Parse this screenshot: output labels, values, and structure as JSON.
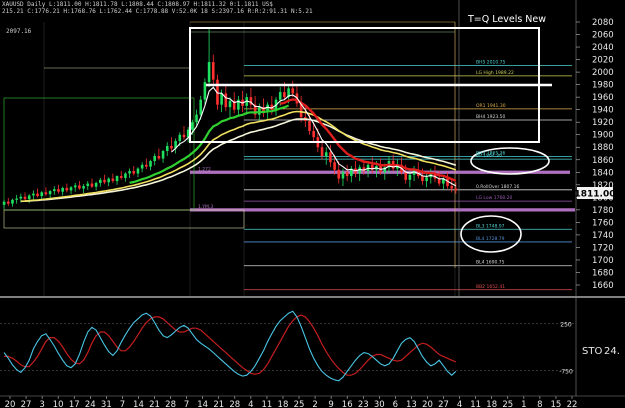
{
  "header": {
    "line1": "XAUUSD Daily  L:1811.00  H:1811.78  L:1808.44  C:1808.97  H:1811.32  0:1.1811  US$",
    "line2": "215.21  C:1776.21  H:1768.76  L:1762.44  C:1778.88  V:52.0K  18  S:2397.16  R:R:2:91.31  N:5.21",
    "line3": "2097.16"
  },
  "title": "T=Q Levels New",
  "price_label": "1811.00",
  "chart_data": {
    "type": "candlestick",
    "ylim": [
      1642,
      2100
    ],
    "y_ticks": [
      2080,
      2060,
      2040,
      2020,
      2000,
      1980,
      1960,
      1940,
      1920,
      1900,
      1880,
      1860,
      1840,
      1820,
      1800,
      1780,
      1760,
      1740,
      1720,
      1700,
      1680,
      1660
    ],
    "x_tick_labels": [
      "20",
      "27",
      "3",
      "10",
      "17",
      "24",
      "31",
      "7",
      "14",
      "21",
      "28",
      "7",
      "14",
      "21",
      "28",
      "4",
      "11",
      "18",
      "25",
      "2",
      "9",
      "16",
      "23",
      "30",
      "6",
      "13",
      "20",
      "27",
      "4",
      "11",
      "18",
      "25",
      "1",
      "8",
      "15",
      "22"
    ],
    "candles": [
      [
        1788,
        1796,
        1782,
        1793
      ],
      [
        1793,
        1799,
        1786,
        1790
      ],
      [
        1790,
        1798,
        1785,
        1796
      ],
      [
        1796,
        1804,
        1790,
        1798
      ],
      [
        1798,
        1806,
        1792,
        1801
      ],
      [
        1801,
        1808,
        1795,
        1797
      ],
      [
        1797,
        1805,
        1791,
        1803
      ],
      [
        1803,
        1811,
        1797,
        1806
      ],
      [
        1806,
        1814,
        1800,
        1802
      ],
      [
        1802,
        1810,
        1796,
        1808
      ],
      [
        1808,
        1816,
        1802,
        1805
      ],
      [
        1805,
        1812,
        1798,
        1810
      ],
      [
        1810,
        1818,
        1804,
        1813
      ],
      [
        1813,
        1820,
        1806,
        1809
      ],
      [
        1809,
        1817,
        1803,
        1815
      ],
      [
        1815,
        1822,
        1808,
        1811
      ],
      [
        1811,
        1818,
        1805,
        1816
      ],
      [
        1816,
        1823,
        1809,
        1819
      ],
      [
        1819,
        1826,
        1812,
        1814
      ],
      [
        1814,
        1821,
        1807,
        1818
      ],
      [
        1818,
        1826,
        1812,
        1822
      ],
      [
        1822,
        1830,
        1815,
        1817
      ],
      [
        1817,
        1825,
        1811,
        1823
      ],
      [
        1823,
        1831,
        1817,
        1828
      ],
      [
        1828,
        1836,
        1821,
        1824
      ],
      [
        1824,
        1832,
        1818,
        1830
      ],
      [
        1830,
        1838,
        1823,
        1826
      ],
      [
        1826,
        1835,
        1820,
        1834
      ],
      [
        1834,
        1842,
        1828,
        1831
      ],
      [
        1831,
        1840,
        1825,
        1838
      ],
      [
        1838,
        1846,
        1831,
        1842
      ],
      [
        1842,
        1850,
        1835,
        1838
      ],
      [
        1838,
        1848,
        1832,
        1846
      ],
      [
        1846,
        1856,
        1840,
        1852
      ],
      [
        1852,
        1862,
        1845,
        1849
      ],
      [
        1849,
        1860,
        1843,
        1858
      ],
      [
        1858,
        1870,
        1851,
        1866
      ],
      [
        1866,
        1878,
        1859,
        1862
      ],
      [
        1862,
        1876,
        1855,
        1874
      ],
      [
        1874,
        1888,
        1866,
        1882
      ],
      [
        1882,
        1896,
        1874,
        1878
      ],
      [
        1878,
        1894,
        1870,
        1890
      ],
      [
        1890,
        1904,
        1882,
        1900
      ],
      [
        1900,
        1914,
        1892,
        1896
      ],
      [
        1896,
        1912,
        1888,
        1908
      ],
      [
        1908,
        1924,
        1900,
        1920
      ],
      [
        1920,
        1940,
        1912,
        1932
      ],
      [
        1932,
        1962,
        1924,
        1956
      ],
      [
        1956,
        1990,
        1948,
        1984
      ],
      [
        1984,
        2072,
        1976,
        2016
      ],
      [
        2016,
        2028,
        1978,
        1988
      ],
      [
        1988,
        1996,
        1940,
        1948
      ],
      [
        1948,
        1972,
        1936,
        1966
      ],
      [
        1966,
        1978,
        1938,
        1944
      ],
      [
        1944,
        1960,
        1928,
        1954
      ],
      [
        1954,
        1968,
        1934,
        1940
      ],
      [
        1940,
        1962,
        1930,
        1956
      ],
      [
        1956,
        1970,
        1936,
        1946
      ],
      [
        1946,
        1966,
        1932,
        1960
      ],
      [
        1960,
        1975,
        1940,
        1948
      ],
      [
        1948,
        1962,
        1926,
        1932
      ],
      [
        1932,
        1950,
        1920,
        1944
      ],
      [
        1944,
        1958,
        1928,
        1936
      ],
      [
        1936,
        1952,
        1924,
        1948
      ],
      [
        1948,
        1962,
        1932,
        1940
      ],
      [
        1940,
        1960,
        1930,
        1956
      ],
      [
        1956,
        1976,
        1946,
        1968
      ],
      [
        1968,
        1984,
        1956,
        1960
      ],
      [
        1960,
        1980,
        1950,
        1974
      ],
      [
        1974,
        1986,
        1960,
        1966
      ],
      [
        1966,
        1978,
        1944,
        1950
      ],
      [
        1950,
        1962,
        1920,
        1928
      ],
      [
        1928,
        1944,
        1912,
        1922
      ],
      [
        1922,
        1934,
        1900,
        1906
      ],
      [
        1906,
        1920,
        1890,
        1896
      ],
      [
        1896,
        1910,
        1872,
        1880
      ],
      [
        1880,
        1892,
        1860,
        1866
      ],
      [
        1866,
        1880,
        1852,
        1872
      ],
      [
        1872,
        1884,
        1848,
        1856
      ],
      [
        1856,
        1868,
        1836,
        1844
      ],
      [
        1844,
        1858,
        1822,
        1830
      ],
      [
        1830,
        1846,
        1818,
        1840
      ],
      [
        1840,
        1852,
        1826,
        1834
      ],
      [
        1834,
        1850,
        1824,
        1846
      ],
      [
        1846,
        1858,
        1832,
        1838
      ],
      [
        1838,
        1852,
        1826,
        1848
      ],
      [
        1848,
        1860,
        1836,
        1842
      ],
      [
        1842,
        1856,
        1832,
        1852
      ],
      [
        1852,
        1864,
        1838,
        1844
      ],
      [
        1844,
        1858,
        1832,
        1850
      ],
      [
        1850,
        1862,
        1836,
        1840
      ],
      [
        1840,
        1854,
        1828,
        1848
      ],
      [
        1848,
        1866,
        1838,
        1858
      ],
      [
        1858,
        1868,
        1842,
        1846
      ],
      [
        1846,
        1860,
        1834,
        1852
      ],
      [
        1852,
        1864,
        1836,
        1840
      ],
      [
        1840,
        1852,
        1822,
        1828
      ],
      [
        1828,
        1842,
        1816,
        1836
      ],
      [
        1836,
        1850,
        1826,
        1844
      ],
      [
        1844,
        1856,
        1830,
        1834
      ],
      [
        1834,
        1846,
        1820,
        1826
      ],
      [
        1826,
        1840,
        1816,
        1832
      ],
      [
        1832,
        1846,
        1822,
        1838
      ],
      [
        1838,
        1850,
        1824,
        1830
      ],
      [
        1830,
        1842,
        1818,
        1822
      ],
      [
        1822,
        1836,
        1812,
        1830
      ],
      [
        1830,
        1840,
        1814,
        1818
      ],
      [
        1818,
        1830,
        1808,
        1814
      ],
      [
        1814,
        1824,
        1806,
        1811
      ]
    ],
    "horizontal_levels": [
      {
        "label": "BH5  2010.75",
        "value": 2010.75,
        "color": "#4fd2d2"
      },
      {
        "label": "LG High  1989.22",
        "value": 1994,
        "color": "#d2d25a"
      },
      {
        "label": "OR1  1941.30",
        "value": 1941.3,
        "color": "#e0b050"
      },
      {
        "label": "BH4  1923.50",
        "value": 1923.5,
        "color": "#d8d8d8"
      },
      {
        "label": "BH3  1865.36",
        "value": 1865.36,
        "color": "#4fd2d2"
      },
      {
        "label": "BP  1864.30",
        "value": 1861,
        "color": "#4fd2d2"
      },
      {
        "label": "1.272",
        "value": 1840,
        "color": "#b070c0"
      },
      {
        "label": "0.RollOver  1807.16",
        "value": 1812,
        "color": "#d8d8d8"
      },
      {
        "label": "LG Low  1768.20",
        "value": 1794,
        "color": "#9b59b6"
      },
      {
        "label": "1.YM.3",
        "value": 1780,
        "color": "#b070c0"
      },
      {
        "label": "BL3  1748.97",
        "value": 1749,
        "color": "#4fd2d2"
      },
      {
        "label": "BL4  1728.79",
        "value": 1728.79,
        "color": "#4f8fd2"
      },
      {
        "label": "BL4  1690.75",
        "value": 1690.75,
        "color": "#d8d8d8"
      },
      {
        "label": "BB2  1652.41",
        "value": 1652.41,
        "color": "#e05050"
      }
    ],
    "colors": {
      "up": "#20e060",
      "down": "#ff3030",
      "ema_fast": "#ffffff",
      "ema_red": "#e01e1e",
      "ema_green": "#30d030",
      "ema_yellow": "#f0e060",
      "ema_slow": "#f5f5dc"
    }
  },
  "stoch": {
    "label": "STO",
    "value_label": "24.",
    "levels": [
      {
        "label": "250",
        "value": 75
      },
      {
        "label": "-750",
        "value": 25
      }
    ],
    "k_values": [
      44,
      38,
      31,
      26,
      23,
      28,
      36,
      48,
      56,
      62,
      64,
      58,
      51,
      43,
      36,
      30,
      28,
      32,
      42,
      55,
      66,
      71,
      68,
      60,
      52,
      45,
      41,
      46,
      55,
      63,
      70,
      76,
      80,
      84,
      86,
      83,
      76,
      68,
      62,
      60,
      63,
      67,
      71,
      73,
      70,
      64,
      58,
      54,
      51,
      48,
      44,
      40,
      36,
      32,
      28,
      24,
      21,
      19,
      20,
      24,
      30,
      38,
      46,
      56,
      64,
      72,
      78,
      82,
      86,
      88,
      82,
      72,
      60,
      48,
      38,
      30,
      24,
      20,
      17,
      15,
      14,
      18,
      24,
      30,
      36,
      41,
      44,
      43,
      40,
      36,
      32,
      30,
      32,
      38,
      46,
      54,
      58,
      60,
      56,
      48,
      40,
      34,
      30,
      32,
      36,
      30,
      24,
      20,
      24
    ],
    "d_values": [
      40,
      40,
      38,
      35,
      31,
      29,
      29,
      34,
      40,
      48,
      56,
      60,
      60,
      56,
      50,
      43,
      37,
      33,
      32,
      36,
      44,
      54,
      62,
      66,
      66,
      62,
      56,
      50,
      46,
      46,
      50,
      56,
      63,
      70,
      76,
      80,
      82,
      82,
      80,
      76,
      72,
      68,
      66,
      66,
      68,
      70,
      70,
      68,
      64,
      60,
      56,
      52,
      48,
      44,
      40,
      36,
      32,
      28,
      25,
      22,
      21,
      22,
      26,
      32,
      40,
      48,
      56,
      64,
      72,
      78,
      82,
      84,
      82,
      77,
      70,
      62,
      53,
      45,
      38,
      32,
      27,
      23,
      20,
      20,
      22,
      26,
      31,
      36,
      40,
      42,
      42,
      40,
      38,
      36,
      35,
      36,
      40,
      44,
      48,
      52,
      54,
      53,
      50,
      46,
      42,
      40,
      38,
      36,
      34
    ]
  }
}
